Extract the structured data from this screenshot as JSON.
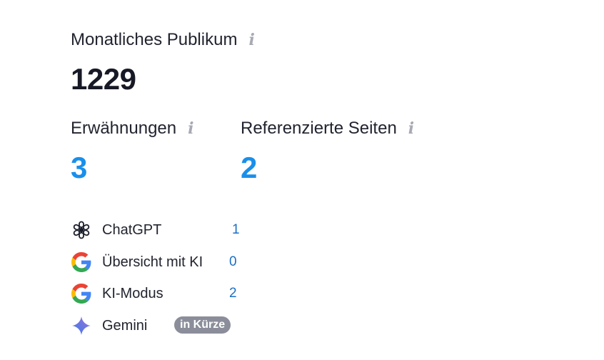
{
  "audience": {
    "label": "Monatliches Publikum",
    "value": "1229"
  },
  "mentions": {
    "label": "Erwähnungen",
    "value": "3"
  },
  "referenced_pages": {
    "label": "Referenzierte Seiten",
    "value": "2"
  },
  "info_glyph": "i",
  "sources": [
    {
      "name": "ChatGPT",
      "count": "1",
      "icon": "chatgpt-icon"
    },
    {
      "name": "Übersicht mit KI",
      "count": "0",
      "icon": "google-icon"
    },
    {
      "name": "KI-Modus",
      "count": "2",
      "icon": "google-icon"
    },
    {
      "name": "Gemini",
      "badge": "in Kürze",
      "icon": "gemini-icon"
    }
  ],
  "colors": {
    "accent_blue": "#1a8fea",
    "count_blue": "#1b6fc7",
    "badge_gray": "#8b8e9a",
    "info_gray": "#a7a9b4"
  }
}
